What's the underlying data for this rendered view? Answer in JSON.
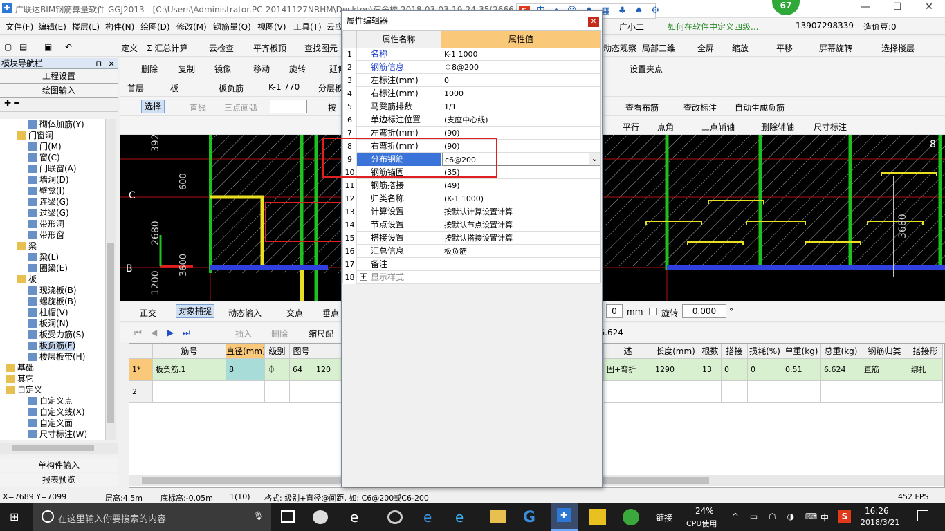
{
  "window": {
    "title": "广联达BIM钢筋算量软件 GGJ2013 - [C:\\Users\\Administrator.PC-20141127NRHM\\Desktop\\宿舍楼 2018-03-03-19-24-35(2666版",
    "min": "—",
    "max": "☐",
    "close": "✕",
    "score": "67"
  },
  "menu": [
    "文件(F)",
    "编辑(E)",
    "楼层(L)",
    "构件(N)",
    "绘图(D)",
    "修改(M)",
    "钢筋量(Q)",
    "视图(V)",
    "工具(T)",
    "云应"
  ],
  "menu_right": {
    "assistant": "广小二",
    "question": "如何在软件中定义四级...",
    "phone": "13907298339",
    "price": "造价豆:0"
  },
  "toolbar1": [
    "定义",
    "Σ 汇总计算",
    "云检查",
    "平齐板顶",
    "查找图元"
  ],
  "toolbar1_right": [
    "动态观察",
    "局部三维",
    "全屏",
    "缩放",
    "平移",
    "屏幕旋转",
    "选择楼层"
  ],
  "toolbar2": [
    "删除",
    "复制",
    "镜像",
    "移动",
    "旋转",
    "延伸"
  ],
  "toolbar2_right": [
    "设置夹点"
  ],
  "toolbar3": {
    "floor": "首层",
    "type": "板",
    "sub": "板负筋",
    "item": "K-1 770",
    "layer": "分层板"
  },
  "toolbar4": [
    "选择",
    "直线",
    "三点画弧",
    "按"
  ],
  "toolbar4_right": [
    "查看布筋",
    "查改标注",
    "自动生成负筋"
  ],
  "toolbar5_right": [
    "平行",
    "点角",
    "三点辅轴",
    "删除辅轴",
    "尺寸标注"
  ],
  "nav": {
    "header": "模块导航栏",
    "pin": "⊓",
    "close": "×",
    "buttons": [
      "工程设置",
      "绘图输入"
    ],
    "bottom": [
      "单构件输入",
      "报表预览"
    ]
  },
  "tree": [
    {
      "label": "砌体加筋(Y)",
      "indent": 2
    },
    {
      "label": "门窗洞",
      "indent": 1,
      "folder": true
    },
    {
      "label": "门(M)",
      "indent": 2
    },
    {
      "label": "窗(C)",
      "indent": 2
    },
    {
      "label": "门联窗(A)",
      "indent": 2
    },
    {
      "label": "墙洞(D)",
      "indent": 2
    },
    {
      "label": "壁龛(I)",
      "indent": 2
    },
    {
      "label": "连梁(G)",
      "indent": 2
    },
    {
      "label": "过梁(G)",
      "indent": 2
    },
    {
      "label": "带形洞",
      "indent": 2
    },
    {
      "label": "带形窗",
      "indent": 2
    },
    {
      "label": "梁",
      "indent": 1,
      "folder": true
    },
    {
      "label": "梁(L)",
      "indent": 2
    },
    {
      "label": "圈梁(E)",
      "indent": 2
    },
    {
      "label": "板",
      "indent": 1,
      "folder": true
    },
    {
      "label": "现浇板(B)",
      "indent": 2
    },
    {
      "label": "螺旋板(B)",
      "indent": 2
    },
    {
      "label": "柱帽(V)",
      "indent": 2
    },
    {
      "label": "板洞(N)",
      "indent": 2
    },
    {
      "label": "板受力筋(S)",
      "indent": 2
    },
    {
      "label": "板负筋(F)",
      "indent": 2,
      "selected": true
    },
    {
      "label": "楼层板带(H)",
      "indent": 2
    },
    {
      "label": "基础",
      "indent": 0,
      "folder": true
    },
    {
      "label": "其它",
      "indent": 0,
      "folder": true
    },
    {
      "label": "自定义",
      "indent": 0,
      "folder": true
    },
    {
      "label": "自定义点",
      "indent": 2
    },
    {
      "label": "自定义线(X)",
      "indent": 2
    },
    {
      "label": "自定义面",
      "indent": 2
    },
    {
      "label": "尺寸标注(W)",
      "indent": 2
    }
  ],
  "canvas": {
    "dims": [
      "392",
      "2680",
      "1200",
      "3680"
    ],
    "axes": [
      "C",
      "B",
      "8"
    ],
    "ydim": [
      "600",
      "3600"
    ]
  },
  "snapbar": [
    "正交",
    "对象捕捉",
    "动态输入",
    "交点",
    "垂点"
  ],
  "snapbar_right": {
    "value": "0",
    "unit": "mm",
    "rotate": "旋转",
    "angle": "0.000",
    "deg": "°"
  },
  "gridtool": [
    "插入",
    "删除",
    "缩尺配"
  ],
  "total": "): 6.624",
  "grid": {
    "headers": [
      "筋号",
      "直径(mm)",
      "级别",
      "图号",
      "",
      "述",
      "长度(mm)",
      "根数",
      "搭接",
      "损耗(%)",
      "单重(kg)",
      "总重(kg)",
      "钢筋归类",
      "搭接形"
    ],
    "rows": [
      {
        "no": "1*",
        "cells": [
          "板负筋.1",
          "8",
          "⏀",
          "64",
          "120",
          "固+弯折",
          "1290",
          "13",
          "0",
          "0",
          "0.51",
          "6.624",
          "直筋",
          "绑扎"
        ]
      },
      {
        "no": "2",
        "cells": [
          "",
          "",
          "",
          "",
          "",
          "",
          "",
          "",
          "",
          "",
          "",
          "",
          "",
          ""
        ]
      }
    ]
  },
  "statusbar": {
    "coords": "X=7689 Y=7099",
    "floor_h": "层高:4.5m",
    "bottom_h": "底标高:-0.05m",
    "count": "1(10)",
    "hint": "格式: 级别+直径@间距, 如: C6@200或C6-200",
    "fps": "452 FPS"
  },
  "taskbar": {
    "search": "在这里输入你要搜索的内容",
    "link": "链接",
    "cpu": "24%",
    "cpu_label": "CPU使用",
    "ime": "中",
    "time": "16:26",
    "date": "2018/3/21"
  },
  "dialog": {
    "title": "属性编辑器",
    "col_name": "属性名称",
    "col_value": "属性值",
    "rows": [
      {
        "n": "1",
        "k": "名称",
        "v": "K-1 1000",
        "blue": true
      },
      {
        "n": "2",
        "k": "钢筋信息",
        "v": "⏀8@200",
        "blue": true
      },
      {
        "n": "3",
        "k": "左标注(mm)",
        "v": "0"
      },
      {
        "n": "4",
        "k": "右标注(mm)",
        "v": "1000"
      },
      {
        "n": "5",
        "k": "马凳筋排数",
        "v": "1/1"
      },
      {
        "n": "6",
        "k": "单边标注位置",
        "v": "(支座中心线)"
      },
      {
        "n": "7",
        "k": "左弯折(mm)",
        "v": "(90)"
      },
      {
        "n": "8",
        "k": "右弯折(mm)",
        "v": "(90)"
      },
      {
        "n": "9",
        "k": "分布钢筋",
        "v": "c6@200",
        "blue": true,
        "selected": true
      },
      {
        "n": "10",
        "k": "钢筋锚固",
        "v": "(35)"
      },
      {
        "n": "11",
        "k": "钢筋搭接",
        "v": "(49)"
      },
      {
        "n": "12",
        "k": "归类名称",
        "v": "(K-1 1000)"
      },
      {
        "n": "13",
        "k": "计算设置",
        "v": "按默认计算设置计算"
      },
      {
        "n": "14",
        "k": "节点设置",
        "v": "按默认节点设置计算"
      },
      {
        "n": "15",
        "k": "搭接设置",
        "v": "按默认搭接设置计算"
      },
      {
        "n": "16",
        "k": "汇总信息",
        "v": "板负筋"
      },
      {
        "n": "17",
        "k": "备注",
        "v": ""
      },
      {
        "n": "18",
        "k": "显示样式",
        "v": "",
        "expand": true
      }
    ]
  },
  "colors": {
    "accent": "#3b74d8",
    "highlight": "#e02020",
    "canvas": "#000000",
    "beam": "#e8e020",
    "column_line": "#20c020"
  }
}
